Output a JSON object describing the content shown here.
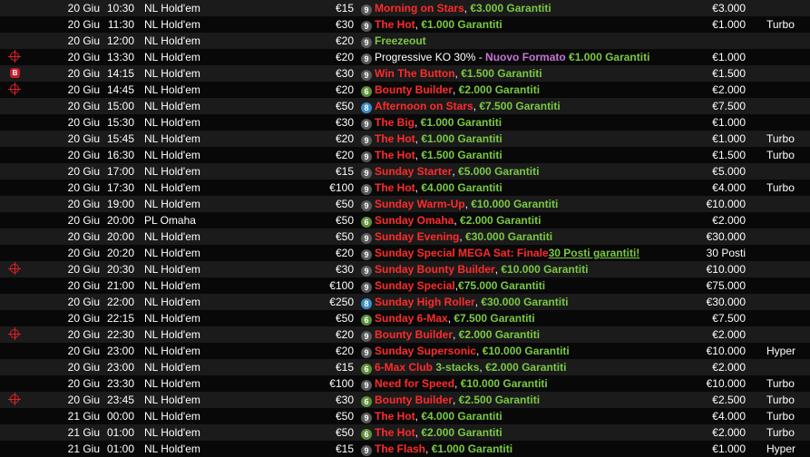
{
  "rows": [
    {
      "icon": "",
      "date": "20 Giu",
      "time": "10:30",
      "game": "NL Hold'em",
      "buyin": "€15",
      "badge": "9",
      "parts": [
        {
          "t": "Morning on Stars",
          "c": "red"
        },
        {
          "t": ", ",
          "c": "white"
        },
        {
          "t": "€3.000 Garantiti",
          "c": "green"
        }
      ],
      "gtd": "€3.000",
      "type": ""
    },
    {
      "icon": "",
      "date": "20 Giu",
      "time": "11:30",
      "game": "NL Hold'em",
      "buyin": "€30",
      "badge": "9",
      "parts": [
        {
          "t": "The Hot",
          "c": "red"
        },
        {
          "t": ", ",
          "c": "white"
        },
        {
          "t": "€1.000 Garantiti",
          "c": "green"
        }
      ],
      "gtd": "€1.000",
      "type": "Turbo"
    },
    {
      "icon": "",
      "date": "20 Giu",
      "time": "12:00",
      "game": "NL Hold'em",
      "buyin": "€20",
      "badge": "9",
      "parts": [
        {
          "t": "Freezeout",
          "c": "green"
        }
      ],
      "gtd": "",
      "type": ""
    },
    {
      "icon": "target",
      "date": "20 Giu",
      "time": "13:30",
      "game": "NL Hold'em",
      "buyin": "€20",
      "badge": "9",
      "parts": [
        {
          "t": "Progressive KO 30% - ",
          "c": "white"
        },
        {
          "t": "Nuovo Formato ",
          "c": "purple"
        },
        {
          "t": "€1.000 Garantiti",
          "c": "green"
        }
      ],
      "gtd": "€1.000",
      "type": ""
    },
    {
      "icon": "b",
      "date": "20 Giu",
      "time": "14:15",
      "game": "NL Hold'em",
      "buyin": "€30",
      "badge": "9",
      "parts": [
        {
          "t": "Win The Button",
          "c": "red"
        },
        {
          "t": ", ",
          "c": "white"
        },
        {
          "t": "€1.500 Garantiti",
          "c": "green"
        }
      ],
      "gtd": "€1.500",
      "type": ""
    },
    {
      "icon": "target",
      "date": "20 Giu",
      "time": "14:45",
      "game": "NL Hold'em",
      "buyin": "€20",
      "badge": "6",
      "parts": [
        {
          "t": "Bounty Builder",
          "c": "red"
        },
        {
          "t": ", ",
          "c": "white"
        },
        {
          "t": "€2.000 Garantiti",
          "c": "green"
        }
      ],
      "gtd": "€2.000",
      "type": ""
    },
    {
      "icon": "",
      "date": "20 Giu",
      "time": "15:00",
      "game": "NL Hold'em",
      "buyin": "€50",
      "badge": "8",
      "parts": [
        {
          "t": "Afternoon on Stars",
          "c": "red"
        },
        {
          "t": ", ",
          "c": "white"
        },
        {
          "t": "€7.500 Garantiti",
          "c": "green"
        }
      ],
      "gtd": "€7.500",
      "type": ""
    },
    {
      "icon": "",
      "date": "20 Giu",
      "time": "15:30",
      "game": "NL Hold'em",
      "buyin": "€30",
      "badge": "9",
      "parts": [
        {
          "t": "The Big",
          "c": "red"
        },
        {
          "t": ", ",
          "c": "white"
        },
        {
          "t": "€1.000 Garantiti",
          "c": "green"
        }
      ],
      "gtd": "€1.000",
      "type": ""
    },
    {
      "icon": "",
      "date": "20 Giu",
      "time": "15:45",
      "game": "NL Hold'em",
      "buyin": "€20",
      "badge": "9",
      "parts": [
        {
          "t": "The Hot",
          "c": "red"
        },
        {
          "t": ", ",
          "c": "white"
        },
        {
          "t": "€1.000 Garantiti",
          "c": "green"
        }
      ],
      "gtd": "€1.000",
      "type": "Turbo"
    },
    {
      "icon": "",
      "date": "20 Giu",
      "time": "16:30",
      "game": "NL Hold'em",
      "buyin": "€20",
      "badge": "9",
      "parts": [
        {
          "t": "The Hot",
          "c": "red"
        },
        {
          "t": ", ",
          "c": "white"
        },
        {
          "t": "€1.500 Garantiti",
          "c": "green"
        }
      ],
      "gtd": "€1.500",
      "type": "Turbo"
    },
    {
      "icon": "",
      "date": "20 Giu",
      "time": "17:00",
      "game": "NL Hold'em",
      "buyin": "€15",
      "badge": "9",
      "parts": [
        {
          "t": "Sunday Starter",
          "c": "red"
        },
        {
          "t": ", ",
          "c": "white"
        },
        {
          "t": "€5.000 Garantiti",
          "c": "green"
        }
      ],
      "gtd": "€5.000",
      "type": ""
    },
    {
      "icon": "",
      "date": "20 Giu",
      "time": "17:30",
      "game": "NL Hold'em",
      "buyin": "€100",
      "badge": "9",
      "parts": [
        {
          "t": "The Hot",
          "c": "red"
        },
        {
          "t": ", ",
          "c": "white"
        },
        {
          "t": "€4.000 Garantiti",
          "c": "green"
        }
      ],
      "gtd": "€4.000",
      "type": "Turbo"
    },
    {
      "icon": "",
      "date": "20 Giu",
      "time": "19:00",
      "game": "NL Hold'em",
      "buyin": "€50",
      "badge": "9",
      "parts": [
        {
          "t": "Sunday Warm-Up",
          "c": "red"
        },
        {
          "t": ", ",
          "c": "white"
        },
        {
          "t": "€10.000 Garantiti",
          "c": "green"
        }
      ],
      "gtd": "€10.000",
      "type": ""
    },
    {
      "icon": "",
      "date": "20 Giu",
      "time": "20:00",
      "game": "PL Omaha",
      "buyin": "€50",
      "badge": "6",
      "parts": [
        {
          "t": "Sunday Omaha",
          "c": "red"
        },
        {
          "t": ", ",
          "c": "white"
        },
        {
          "t": "€2.000 Garantiti",
          "c": "green"
        }
      ],
      "gtd": "€2.000",
      "type": ""
    },
    {
      "icon": "",
      "date": "20 Giu",
      "time": "20:00",
      "game": "NL Hold'em",
      "buyin": "€50",
      "badge": "9",
      "parts": [
        {
          "t": "Sunday Evening",
          "c": "red"
        },
        {
          "t": ", ",
          "c": "white"
        },
        {
          "t": "€30.000 Garantiti",
          "c": "green"
        }
      ],
      "gtd": "€30.000",
      "type": ""
    },
    {
      "icon": "",
      "date": "20 Giu",
      "time": "20:20",
      "game": "NL Hold'em",
      "buyin": "€20",
      "badge": "9",
      "parts": [
        {
          "t": "Sunday Special MEGA Sat: Finale",
          "c": "red"
        },
        {
          "t": "30 Posti garantiti!",
          "c": "link"
        }
      ],
      "gtd": "30 Posti",
      "type": ""
    },
    {
      "icon": "target",
      "date": "20 Giu",
      "time": "20:30",
      "game": "NL Hold'em",
      "buyin": "€30",
      "badge": "9",
      "parts": [
        {
          "t": "Sunday Bounty Builder",
          "c": "red"
        },
        {
          "t": ", ",
          "c": "white"
        },
        {
          "t": "€10.000 Garantiti",
          "c": "green"
        }
      ],
      "gtd": "€10.000",
      "type": ""
    },
    {
      "icon": "",
      "date": "20 Giu",
      "time": "21:00",
      "game": "NL Hold'em",
      "buyin": "€100",
      "badge": "9",
      "parts": [
        {
          "t": "Sunday Special",
          "c": "red"
        },
        {
          "t": ",",
          "c": "white"
        },
        {
          "t": "€75.000 Garantiti",
          "c": "green"
        }
      ],
      "gtd": "€75.000",
      "type": ""
    },
    {
      "icon": "",
      "date": "20 Giu",
      "time": "22:00",
      "game": "NL Hold'em",
      "buyin": "€250",
      "badge": "8",
      "parts": [
        {
          "t": "Sunday High Roller",
          "c": "red"
        },
        {
          "t": ", ",
          "c": "white"
        },
        {
          "t": "€30.000 Garantiti",
          "c": "green"
        }
      ],
      "gtd": "€30.000",
      "type": ""
    },
    {
      "icon": "",
      "date": "20 Giu",
      "time": "22:15",
      "game": "NL Hold'em",
      "buyin": "€50",
      "badge": "6",
      "parts": [
        {
          "t": "Sunday 6-Max",
          "c": "red"
        },
        {
          "t": ", ",
          "c": "white"
        },
        {
          "t": "€7.500 Garantiti",
          "c": "green"
        }
      ],
      "gtd": "€7.500",
      "type": ""
    },
    {
      "icon": "target",
      "date": "20 Giu",
      "time": "22:30",
      "game": "NL Hold'em",
      "buyin": "€20",
      "badge": "9",
      "parts": [
        {
          "t": "Bounty Builder",
          "c": "red"
        },
        {
          "t": ", ",
          "c": "white"
        },
        {
          "t": "€2.000 Garantiti",
          "c": "green"
        }
      ],
      "gtd": "€2.000",
      "type": ""
    },
    {
      "icon": "",
      "date": "20 Giu",
      "time": "23:00",
      "game": "NL Hold'em",
      "buyin": "€20",
      "badge": "9",
      "parts": [
        {
          "t": "Sunday Supersonic",
          "c": "red"
        },
        {
          "t": ", ",
          "c": "white"
        },
        {
          "t": "€10.000 Garantiti",
          "c": "green"
        }
      ],
      "gtd": "€10.000",
      "type": "Hyper"
    },
    {
      "icon": "",
      "date": "20 Giu",
      "time": "23:00",
      "game": "NL Hold'em",
      "buyin": "€15",
      "badge": "6",
      "parts": [
        {
          "t": "6-Max Club ",
          "c": "red"
        },
        {
          "t": "3-stacks",
          "c": "green"
        },
        {
          "t": ", ",
          "c": "white"
        },
        {
          "t": "€2.000 Garantiti",
          "c": "green"
        }
      ],
      "gtd": "€2.000",
      "type": ""
    },
    {
      "icon": "",
      "date": "20 Giu",
      "time": "23:30",
      "game": "NL Hold'em",
      "buyin": "€100",
      "badge": "9",
      "parts": [
        {
          "t": "Need for Speed",
          "c": "red"
        },
        {
          "t": ", ",
          "c": "white"
        },
        {
          "t": "€10.000 Garantiti",
          "c": "green"
        }
      ],
      "gtd": "€10.000",
      "type": "Turbo"
    },
    {
      "icon": "target",
      "date": "20 Giu",
      "time": "23:45",
      "game": "NL Hold'em",
      "buyin": "€30",
      "badge": "6",
      "parts": [
        {
          "t": "Bounty Builder",
          "c": "red"
        },
        {
          "t": ", ",
          "c": "white"
        },
        {
          "t": "€2.500 Garantiti",
          "c": "green"
        }
      ],
      "gtd": "€2.500",
      "type": "Turbo"
    },
    {
      "icon": "",
      "date": "21 Giu",
      "time": "00:00",
      "game": "NL Hold'em",
      "buyin": "€50",
      "badge": "9",
      "parts": [
        {
          "t": "The Hot",
          "c": "red"
        },
        {
          "t": ", ",
          "c": "white"
        },
        {
          "t": "€4.000 Garantiti",
          "c": "green"
        }
      ],
      "gtd": "€4.000",
      "type": "Turbo"
    },
    {
      "icon": "",
      "date": "21 Giu",
      "time": "01:00",
      "game": "NL Hold'em",
      "buyin": "€50",
      "badge": "6",
      "parts": [
        {
          "t": "The Hot",
          "c": "red"
        },
        {
          "t": ", ",
          "c": "white"
        },
        {
          "t": "€2.000 Garantiti",
          "c": "green"
        }
      ],
      "gtd": "€2.000",
      "type": "Turbo"
    },
    {
      "icon": "",
      "date": "21 Giu",
      "time": "01:00",
      "game": "NL Hold'em",
      "buyin": "€15",
      "badge": "9",
      "parts": [
        {
          "t": "The Flash",
          "c": "red"
        },
        {
          "t": ", ",
          "c": "white"
        },
        {
          "t": "€1.000 Garantiti",
          "c": "green"
        }
      ],
      "gtd": "€1.000",
      "type": "Hyper"
    }
  ],
  "icon_names": {
    "target": "bounty-target-icon",
    "b": "button-b-icon"
  },
  "icon_glyphs": {
    "b": "B"
  },
  "badge_colors": {
    "9": "#5a5a5a",
    "6": "#5f8f3a",
    "8": "#3c8fc4"
  },
  "text_colors": {
    "red": "#ff2b2b",
    "green": "#7ac943",
    "white": "#ffffff",
    "purple": "#c774d6"
  }
}
